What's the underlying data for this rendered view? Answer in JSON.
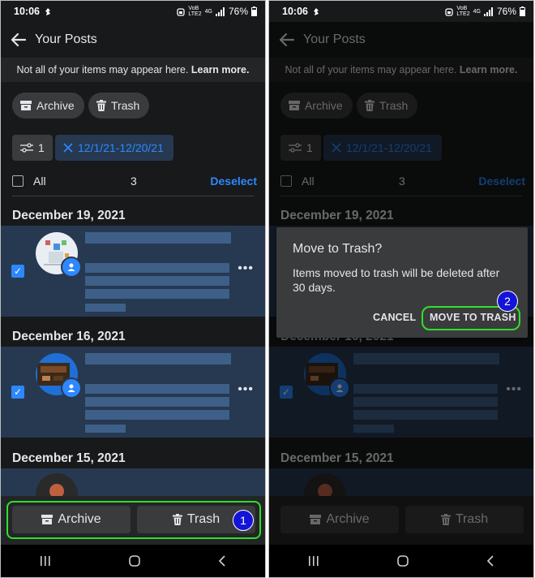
{
  "status_bar": {
    "time": "10:06",
    "network_top": "VoB",
    "network_bottom": "LTE2",
    "network_type": "4G",
    "battery": "76%"
  },
  "header": {
    "title": "Your Posts"
  },
  "notice": {
    "text": "Not all of your items may appear here. ",
    "link": "Learn more."
  },
  "chips": {
    "archive": "Archive",
    "trash": "Trash"
  },
  "filter": {
    "count": "1",
    "date_range": "12/1/21-12/20/21"
  },
  "selection": {
    "all_label": "All",
    "count": "3",
    "deselect": "Deselect"
  },
  "groups": [
    {
      "date": "December 19, 2021"
    },
    {
      "date": "December 16, 2021"
    },
    {
      "date": "December 15, 2021"
    }
  ],
  "bottom_actions": {
    "archive": "Archive",
    "trash": "Trash"
  },
  "steps": {
    "one": "1",
    "two": "2"
  },
  "dialog": {
    "title": "Move to Trash?",
    "message": "Items moved to trash will be deleted after 30 days.",
    "cancel": "CANCEL",
    "confirm": "MOVE TO TRASH"
  },
  "colors": {
    "background": "#18191a",
    "surface": "#242526",
    "chip": "#3a3b3c",
    "accent": "#2d88ff",
    "selected_row": "#263951",
    "highlight": "#2ee02e",
    "step_badge": "#1414d8"
  },
  "icons": [
    "back-arrow-icon",
    "archive-box-icon",
    "trash-can-icon",
    "filter-sliders-icon",
    "close-x-icon",
    "checkmark-icon",
    "more-dots-icon",
    "person-badge-icon",
    "recents-icon",
    "home-icon",
    "nav-back-icon"
  ]
}
